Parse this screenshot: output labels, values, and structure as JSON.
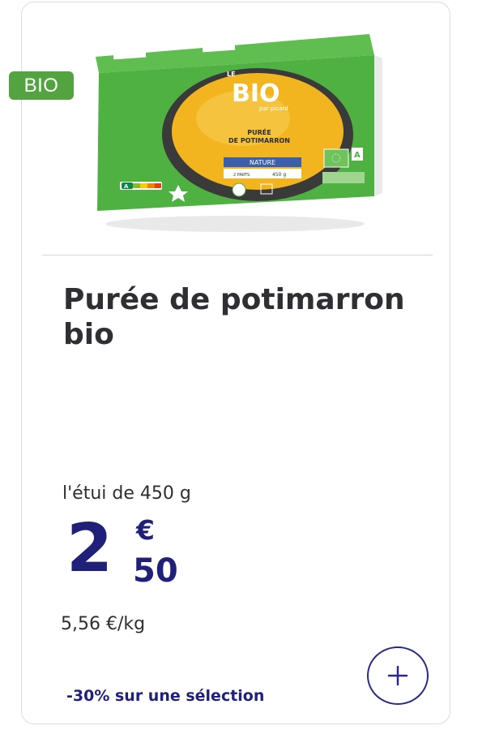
{
  "badge": {
    "label": "BIO"
  },
  "product": {
    "title": "Purée de potimarron bio",
    "unit": "l'étui de 450 g",
    "price": {
      "integer": "2",
      "currency": "€",
      "decimal": "50"
    },
    "price_per_kg": "5,56 €/kg",
    "promo": "-30% sur une sélection",
    "package": {
      "brand_top": "LE",
      "brand": "BIO",
      "brand_sub": "par picard",
      "name_line1": "PURÉE",
      "name_line2": "DE POTIMARRON",
      "variant": "NATURE",
      "parts": "2 PARTS",
      "weight": "450 g",
      "nutriscore": "A"
    }
  },
  "colors": {
    "bio_green": "#53a441",
    "price_navy": "#20207a",
    "package_green": "#4fb142",
    "puree_orange": "#f2b51f"
  },
  "icons": {
    "add": "plus-icon"
  }
}
